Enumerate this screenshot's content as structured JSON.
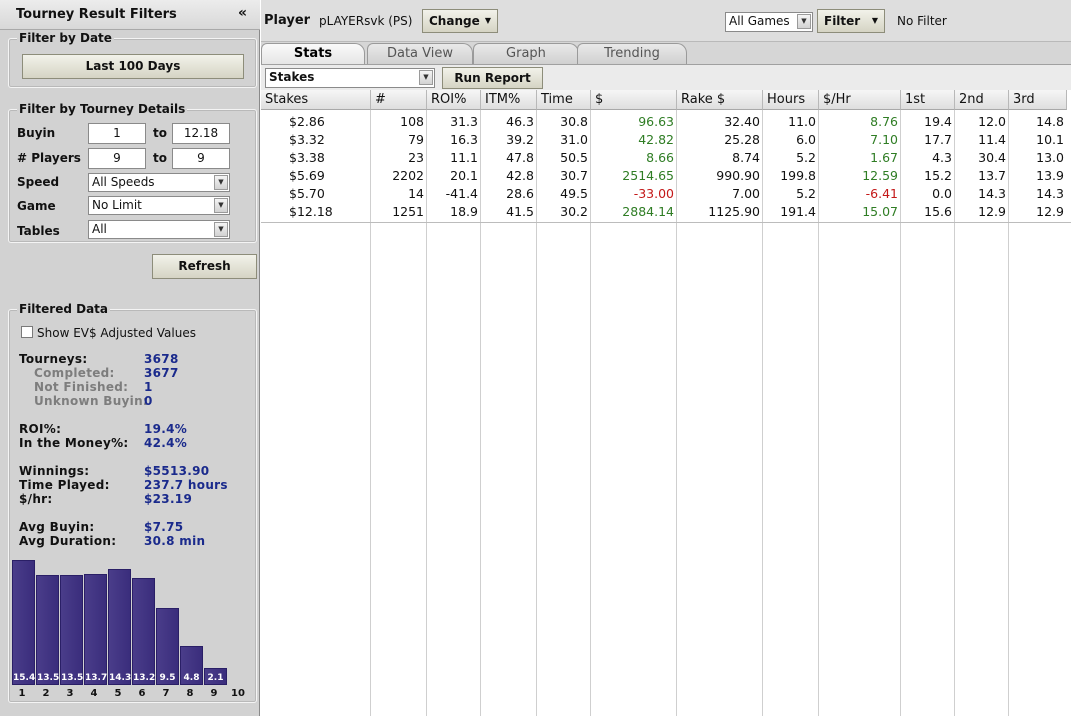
{
  "sidebar": {
    "title": "Tourney Result Filters",
    "collapse_icon": "«",
    "filter_by_date": {
      "title": "Filter by Date",
      "button": "Last 100 Days"
    },
    "filter_by_tourney": {
      "title": "Filter by Tourney Details",
      "buyin_label": "Buyin",
      "buyin_from": "1",
      "to": "to",
      "buyin_to": "12.18",
      "players_label": "# Players",
      "players_from": "9",
      "players_to": "9",
      "speed_label": "Speed",
      "speed_value": "All Speeds",
      "game_label": "Game",
      "game_value": "No Limit",
      "tables_label": "Tables",
      "tables_value": "All"
    },
    "refresh_button": "Refresh",
    "filtered": {
      "title": "Filtered Data",
      "ev_checkbox_label": "Show EV$ Adjusted Values",
      "ev_checked": false,
      "tourneys_label": "Tourneys:",
      "tourneys": "3678",
      "completed_label": "Completed:",
      "completed": "3677",
      "notfinished_label": "Not Finished:",
      "notfinished": "1",
      "unknown_label": "Unknown Buyin:",
      "unknown": "0",
      "roi_label": "ROI%:",
      "roi": "19.4%",
      "itm_label": "In the Money%:",
      "itm": "42.4%",
      "winnings_label": "Winnings:",
      "winnings": "$5513.90",
      "time_label": "Time Played:",
      "time": "237.7 hours",
      "perhour_label": "$/hr:",
      "perhour": "$23.19",
      "avgbuyin_label": "Avg Buyin:",
      "avgbuyin": "$7.75",
      "avgdur_label": "Avg Duration:",
      "avgdur": "30.8 min"
    },
    "histogram": {
      "bars": [
        {
          "label": "1",
          "value": 15.4
        },
        {
          "label": "2",
          "value": 13.5
        },
        {
          "label": "3",
          "value": 13.5
        },
        {
          "label": "4",
          "value": 13.7
        },
        {
          "label": "5",
          "value": 14.3
        },
        {
          "label": "6",
          "value": 13.2
        },
        {
          "label": "7",
          "value": 9.5
        },
        {
          "label": "8",
          "value": 4.8
        },
        {
          "label": "9",
          "value": 2.1
        },
        {
          "label": "10",
          "value": null
        }
      ]
    }
  },
  "topbar": {
    "player_label": "Player",
    "player_name": "pLAYERsvk (PS)",
    "change_button": "Change",
    "games_select": "All Games",
    "filter_button": "Filter",
    "filter_status": "No Filter"
  },
  "tabs": [
    "Stats",
    "Data View",
    "Graph",
    "Trending"
  ],
  "report": {
    "select": "Stakes",
    "run_button": "Run Report"
  },
  "table": {
    "columns": [
      "Stakes",
      "#",
      "ROI%",
      "ITM%",
      "Time",
      "$",
      "Rake $",
      "Hours",
      "$/Hr",
      "1st",
      "2nd",
      "3rd"
    ],
    "rows": [
      [
        "$2.86",
        "108",
        "31.3",
        "46.3",
        "30.8",
        "96.63",
        "32.40",
        "11.0",
        "8.76",
        "19.4",
        "12.0",
        "14.8"
      ],
      [
        "$3.32",
        "79",
        "16.3",
        "39.2",
        "31.0",
        "42.82",
        "25.28",
        "6.0",
        "7.10",
        "17.7",
        "11.4",
        "10.1"
      ],
      [
        "$3.38",
        "23",
        "11.1",
        "47.8",
        "50.5",
        "8.66",
        "8.74",
        "5.2",
        "1.67",
        "4.3",
        "30.4",
        "13.0"
      ],
      [
        "$5.69",
        "2202",
        "20.1",
        "42.8",
        "30.7",
        "2514.65",
        "990.90",
        "199.8",
        "12.59",
        "15.2",
        "13.7",
        "13.9"
      ],
      [
        "$5.70",
        "14",
        "-41.4",
        "28.6",
        "49.5",
        "-33.00",
        "7.00",
        "5.2",
        "-6.41",
        "0.0",
        "14.3",
        "14.3"
      ],
      [
        "$12.18",
        "1251",
        "18.9",
        "41.5",
        "30.2",
        "2884.14",
        "1125.90",
        "191.4",
        "15.07",
        "15.6",
        "12.9",
        "12.9"
      ]
    ],
    "positive_color": "#2f7d24",
    "negative_color": "#c41818"
  }
}
